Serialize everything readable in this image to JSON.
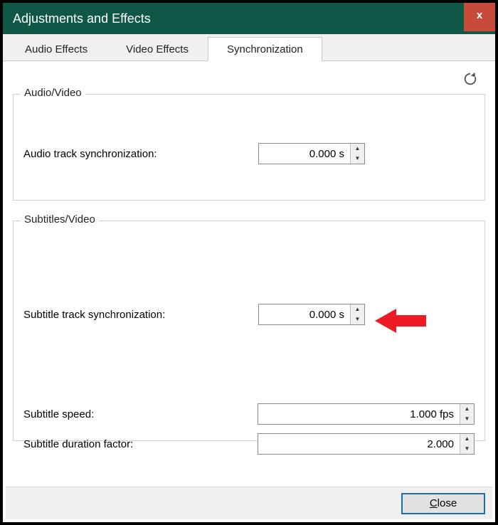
{
  "window": {
    "title": "Adjustments and Effects",
    "close_x": "x"
  },
  "tabs": [
    {
      "label": "Audio Effects"
    },
    {
      "label": "Video Effects"
    },
    {
      "label": "Synchronization"
    }
  ],
  "group_av": {
    "legend": "Audio/Video",
    "audio_sync_label": "Audio track synchronization:",
    "audio_sync_value": "0.000 s"
  },
  "group_sv": {
    "legend": "Subtitles/Video",
    "subtitle_sync_label": "Subtitle track synchronization:",
    "subtitle_sync_value": "0.000 s",
    "subtitle_speed_label": "Subtitle speed:",
    "subtitle_speed_value": "1.000 fps",
    "subtitle_factor_label": "Subtitle duration factor:",
    "subtitle_factor_value": "2.000"
  },
  "buttons": {
    "close": "Close"
  },
  "icons": {
    "refresh": "refresh-icon",
    "annotation_arrow": "annotation-arrow"
  }
}
